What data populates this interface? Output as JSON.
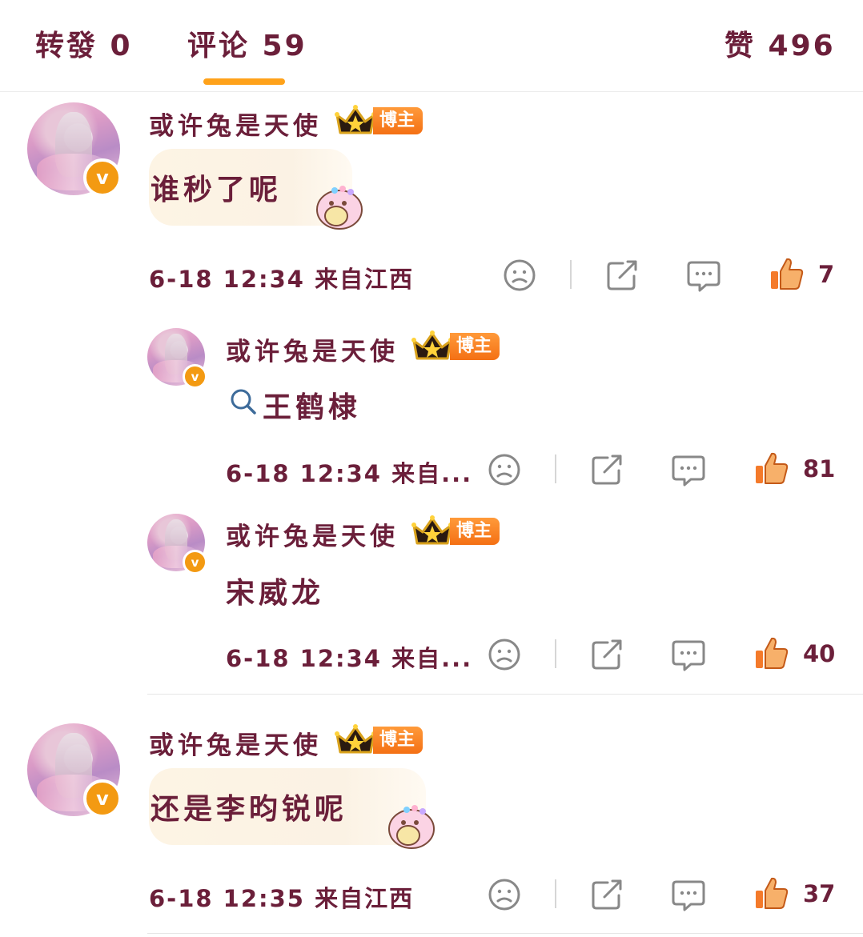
{
  "tabs": [
    {
      "label": "转發 0"
    },
    {
      "label": "评论 59"
    },
    {
      "label": "赞 496"
    }
  ],
  "badge_label": "博主",
  "colors": {
    "text": "#6b1f3a",
    "accent": "#ffa21a",
    "badge": "#f47014",
    "like": "#f3a04a",
    "bubble": "#fdf4e4"
  },
  "comments": [
    {
      "username": "或许兔是天使",
      "text": "谁秒了呢",
      "time": "6-18 12:34",
      "location": "来自江西",
      "likes": "7"
    },
    {
      "username": "或许兔是天使",
      "search_text": "王鹤棣",
      "time": "6-18 12:34",
      "location": "来自...",
      "likes": "81"
    },
    {
      "username": "或许兔是天使",
      "text": "宋威龙",
      "time": "6-18 12:34",
      "location": "来自...",
      "likes": "40"
    },
    {
      "username": "或许兔是天使",
      "text": "还是李昀锐呢",
      "time": "6-18 12:35",
      "location": "来自江西",
      "likes": "37"
    }
  ],
  "icons": [
    "sad-face-icon",
    "share-icon",
    "comment-icon",
    "thumbs-up-icon",
    "crown-icon",
    "search-icon",
    "verified-v-icon"
  ]
}
